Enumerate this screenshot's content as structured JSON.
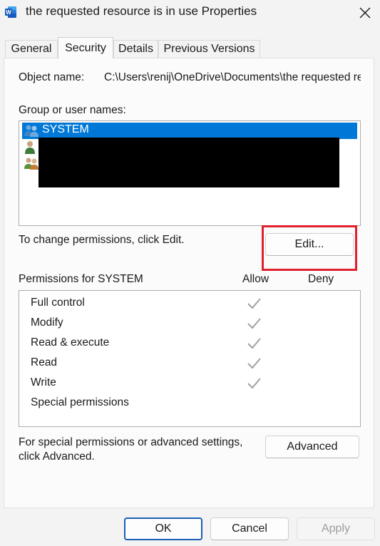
{
  "window": {
    "title": "the requested resource is in use Properties",
    "app_icon": "word-document-icon",
    "close_icon": "close-icon"
  },
  "tabs": [
    {
      "label": "General",
      "active": false
    },
    {
      "label": "Security",
      "active": true
    },
    {
      "label": "Details",
      "active": false
    },
    {
      "label": "Previous Versions",
      "active": false
    }
  ],
  "security": {
    "object_name_label": "Object name:",
    "object_name_value": "C:\\Users\\renij\\OneDrive\\Documents\\the requested resource is in use.docx",
    "group_label": "Group or user names:",
    "users": [
      {
        "name": "SYSTEM",
        "icon": "user-group-icon",
        "selected": true
      },
      {
        "name": "",
        "icon": "user-icon",
        "selected": false,
        "redacted": true
      },
      {
        "name": "",
        "icon": "users-icon",
        "selected": false,
        "redacted": true
      }
    ],
    "change_hint": "To change permissions, click Edit.",
    "edit_button": "Edit...",
    "permissions_label": "Permissions for SYSTEM",
    "allow_header": "Allow",
    "deny_header": "Deny",
    "permissions": [
      {
        "name": "Full control",
        "allow": true,
        "deny": false
      },
      {
        "name": "Modify",
        "allow": true,
        "deny": false
      },
      {
        "name": "Read & execute",
        "allow": true,
        "deny": false
      },
      {
        "name": "Read",
        "allow": true,
        "deny": false
      },
      {
        "name": "Write",
        "allow": true,
        "deny": false
      },
      {
        "name": "Special permissions",
        "allow": false,
        "deny": false
      }
    ],
    "special_hint_line1": "For special permissions or advanced settings,",
    "special_hint_line2": "click Advanced.",
    "advanced_button": "Advanced"
  },
  "footer": {
    "ok": "OK",
    "cancel": "Cancel",
    "apply": "Apply"
  },
  "colors": {
    "selection": "#0078d7",
    "highlight": "#e0202a",
    "check": "#a0a0a0"
  }
}
